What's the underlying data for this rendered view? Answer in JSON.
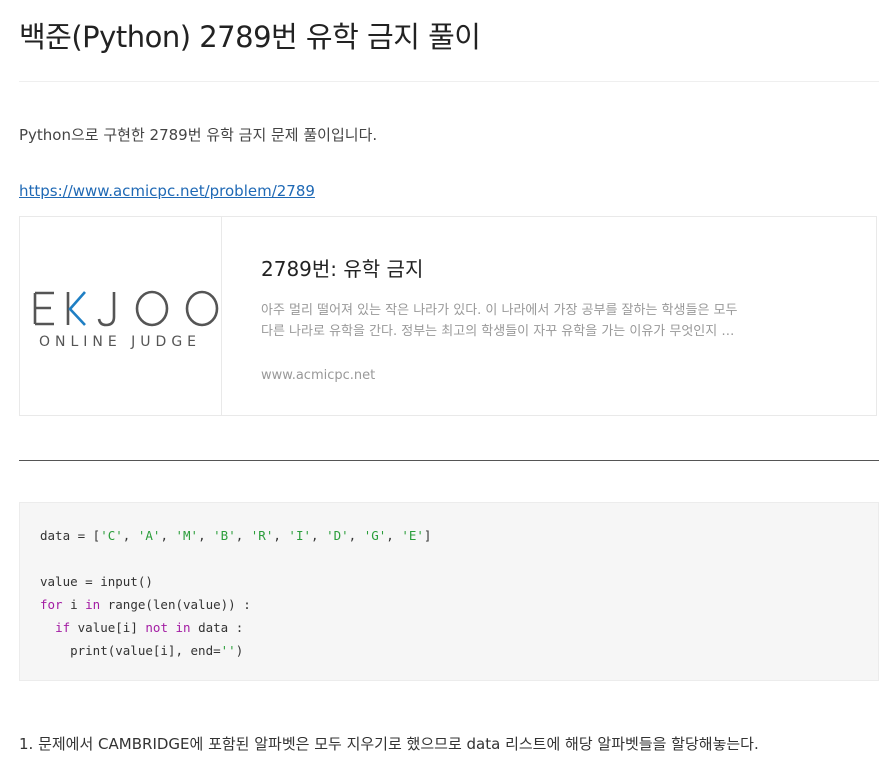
{
  "post": {
    "title": "백준(Python) 2789번 유학 금지 풀이",
    "intro": "Python으로 구현한 2789번 유학 금지 문제 풀이입니다.",
    "link": "https://www.acmicpc.net/problem/2789"
  },
  "og_card": {
    "logo_main": "BAEKJOON",
    "logo_sub": "ONLINE JUDGE",
    "title": "2789번: 유학 금지",
    "description": "아주 멀리 떨어져 있는 작은 나라가 있다. 이 나라에서 가장 공부를 잘하는 학생들은 모두 다른 나라로 유학을 간다. 정부는 최고의 학생들이 자꾸 유학을 가는 이유가 무엇인지 조사했다.",
    "host": "www.acmicpc.net",
    "logo_color": "#1f7fc4"
  },
  "code": {
    "l1_a": "data = [",
    "s_c": "'C'",
    "s_a": "'A'",
    "s_m": "'M'",
    "s_b": "'B'",
    "s_r": "'R'",
    "s_i": "'I'",
    "s_d": "'D'",
    "s_g": "'G'",
    "s_e": "'E'",
    "comma": ", ",
    "l1_end": "]",
    "l3": "value = input()",
    "kw_for": "for",
    "l4_mid1": " i ",
    "kw_in": "in",
    "l4_rest": " range(len(value)) :",
    "l5_ind": "  ",
    "kw_if": "if",
    "l5_mid": " value[i] ",
    "kw_not": "not",
    "l5_sp": " ",
    "kw_in2": "in",
    "l5_rest": " data :",
    "l6_a": "    print(value[i], end=",
    "l6_str": "''",
    "l6_end": ")"
  },
  "step1": "1. 문제에서 CAMBRIDGE에 포함된 알파벳은 모두 지우기로 했으므로 data 리스트에 해당 알파벳들을 할당해놓는다."
}
